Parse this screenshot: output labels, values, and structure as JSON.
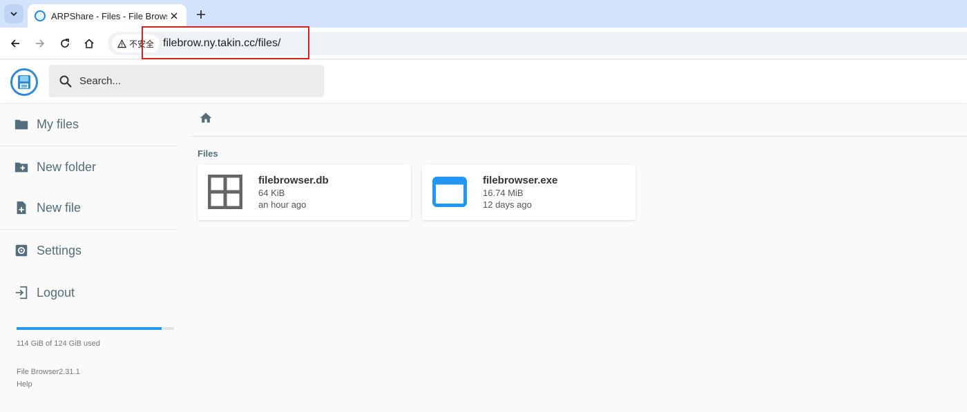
{
  "browser": {
    "tab_title": "ARPShare - Files - File Browser",
    "security_label": "不安全",
    "url": "filebrow.ny.takin.cc/files/",
    "icons": {
      "tab_menu": "chevron-down-icon",
      "close": "close-icon",
      "new_tab": "plus-icon",
      "back": "arrow-left-icon",
      "forward": "arrow-right-icon",
      "reload": "reload-icon",
      "home": "home-icon",
      "warning": "warning-icon"
    },
    "annotation_color": "#d62020"
  },
  "header": {
    "search_placeholder": "Search..."
  },
  "sidebar": {
    "items": [
      {
        "label": "My files",
        "icon": "folder-icon"
      },
      {
        "label": "New folder",
        "icon": "create-new-folder-icon"
      },
      {
        "label": "New file",
        "icon": "note-add-icon"
      },
      {
        "label": "Settings",
        "icon": "settings-icon"
      },
      {
        "label": "Logout",
        "icon": "logout-icon"
      }
    ],
    "usage_fraction": 0.92,
    "usage_text": "114 GiB of 124 GiB used",
    "version": "File Browser2.31.1",
    "help": "Help"
  },
  "main": {
    "breadcrumb_icon": "home-icon",
    "section_title": "Files",
    "files": [
      {
        "name": "filebrowser.db",
        "size": "64 KiB",
        "modified": "an hour ago",
        "icon": "grid-icon"
      },
      {
        "name": "filebrowser.exe",
        "size": "16.74 MiB",
        "modified": "12 days ago",
        "icon": "application-icon"
      }
    ]
  },
  "colors": {
    "accent": "#2196f3",
    "sidebar_text": "#546e7a",
    "tabstrip": "#d3e3fd"
  }
}
